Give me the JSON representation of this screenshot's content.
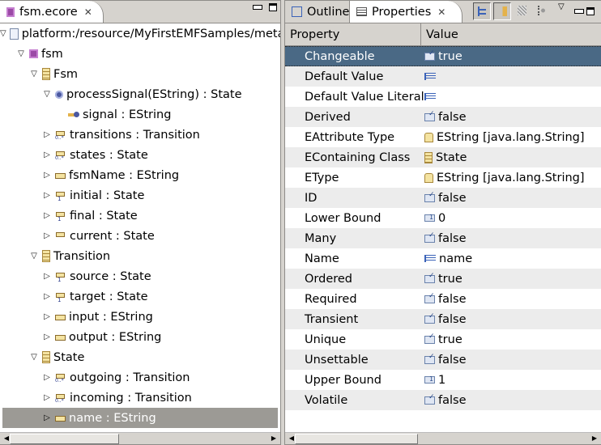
{
  "left_panel": {
    "tab_label": "fsm.ecore",
    "tab_icon": "ecore-file-icon",
    "tree": [
      {
        "label": "platform:/resource/MyFirstEMFSamples/meta",
        "icon": "resource-file-icon",
        "depth": 0,
        "state": "expanded"
      },
      {
        "label": "fsm",
        "icon": "package-icon",
        "depth": 1,
        "state": "expanded"
      },
      {
        "label": "Fsm",
        "icon": "class-icon",
        "depth": 2,
        "state": "expanded"
      },
      {
        "label": "processSignal(EString) : State",
        "icon": "operation-icon",
        "depth": 3,
        "state": "expanded"
      },
      {
        "label": "signal : EString",
        "icon": "parameter-icon",
        "depth": 4,
        "state": "leaf"
      },
      {
        "label": "transitions : Transition",
        "icon": "reference-many-icon",
        "depth": 3,
        "state": "collapsed"
      },
      {
        "label": "states : State",
        "icon": "reference-many-icon",
        "depth": 3,
        "state": "collapsed"
      },
      {
        "label": "fsmName : EString",
        "icon": "attribute-icon",
        "depth": 3,
        "state": "collapsed"
      },
      {
        "label": "initial : State",
        "icon": "reference-one-icon",
        "depth": 3,
        "state": "collapsed"
      },
      {
        "label": "final : State",
        "icon": "reference-one-icon",
        "depth": 3,
        "state": "collapsed"
      },
      {
        "label": "current : State",
        "icon": "reference-icon",
        "depth": 3,
        "state": "collapsed"
      },
      {
        "label": "Transition",
        "icon": "class-icon",
        "depth": 2,
        "state": "expanded"
      },
      {
        "label": "source : State",
        "icon": "reference-one-icon",
        "depth": 3,
        "state": "collapsed"
      },
      {
        "label": "target : State",
        "icon": "reference-one-icon",
        "depth": 3,
        "state": "collapsed"
      },
      {
        "label": "input : EString",
        "icon": "attribute-icon",
        "depth": 3,
        "state": "collapsed"
      },
      {
        "label": "output : EString",
        "icon": "attribute-icon",
        "depth": 3,
        "state": "collapsed"
      },
      {
        "label": "State",
        "icon": "class-icon",
        "depth": 2,
        "state": "expanded"
      },
      {
        "label": "outgoing : Transition",
        "icon": "reference-many-icon",
        "depth": 3,
        "state": "collapsed"
      },
      {
        "label": "incoming : Transition",
        "icon": "reference-many-icon",
        "depth": 3,
        "state": "collapsed"
      },
      {
        "label": "name : EString",
        "icon": "attribute-icon",
        "depth": 3,
        "state": "collapsed",
        "selected": true
      }
    ]
  },
  "right_panel": {
    "tabs": [
      {
        "label": "Outline",
        "icon": "outline-icon",
        "active": false
      },
      {
        "label": "Properties",
        "icon": "properties-icon",
        "active": true
      }
    ],
    "toolbar": [
      "show-categories-icon",
      "show-advanced-icon",
      "restore-default-icon",
      "filter-icon",
      "view-menu-icon"
    ],
    "columns": {
      "property": "Property",
      "value": "Value"
    },
    "rows": [
      {
        "property": "Changeable",
        "value": "true",
        "icon": "bool",
        "selected": true
      },
      {
        "property": "Default Value",
        "value": "",
        "icon": "text"
      },
      {
        "property": "Default Value Literal",
        "value": "",
        "icon": "text"
      },
      {
        "property": "Derived",
        "value": "false",
        "icon": "bool"
      },
      {
        "property": "EAttribute Type",
        "value": "EString [java.lang.String]",
        "icon": "dtype"
      },
      {
        "property": "EContaining Class",
        "value": "State",
        "icon": "cls"
      },
      {
        "property": "EType",
        "value": "EString [java.lang.String]",
        "icon": "dtype"
      },
      {
        "property": "ID",
        "value": "false",
        "icon": "bool"
      },
      {
        "property": "Lower Bound",
        "value": "0",
        "icon": "num"
      },
      {
        "property": "Many",
        "value": "false",
        "icon": "bool"
      },
      {
        "property": "Name",
        "value": "name",
        "icon": "text"
      },
      {
        "property": "Ordered",
        "value": "true",
        "icon": "bool"
      },
      {
        "property": "Required",
        "value": "false",
        "icon": "bool"
      },
      {
        "property": "Transient",
        "value": "false",
        "icon": "bool"
      },
      {
        "property": "Unique",
        "value": "true",
        "icon": "bool"
      },
      {
        "property": "Unsettable",
        "value": "false",
        "icon": "bool"
      },
      {
        "property": "Upper Bound",
        "value": "1",
        "icon": "num"
      },
      {
        "property": "Volatile",
        "value": "false",
        "icon": "bool"
      }
    ]
  },
  "colors": {
    "selection_blue": "#4a6985",
    "selection_gray": "#9c9a95",
    "chrome": "#d6d3ce"
  }
}
